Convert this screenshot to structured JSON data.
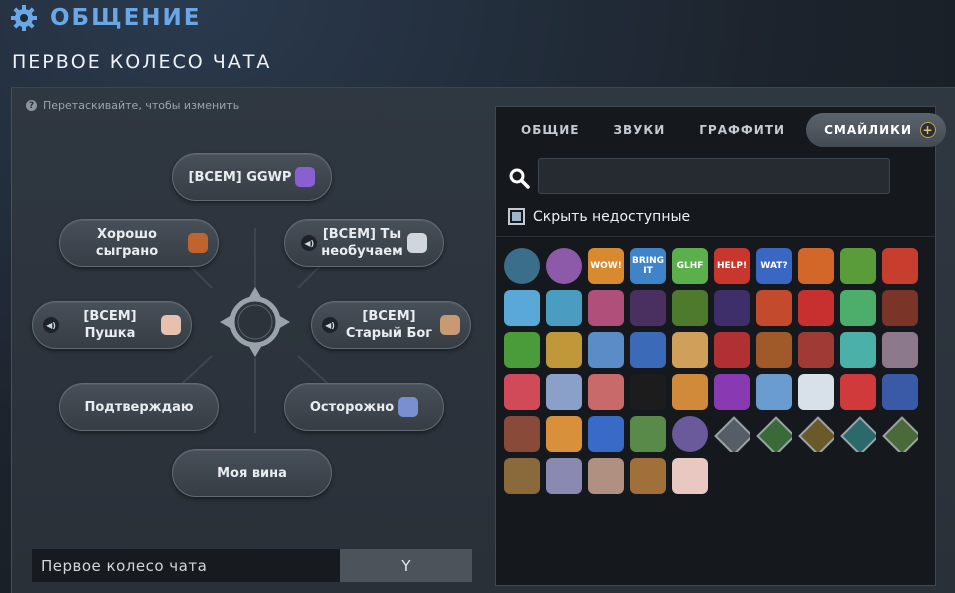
{
  "header": {
    "title": "ОБЩЕНИЕ",
    "subtitle": "ПЕРВОЕ КОЛЕСО ЧАТА",
    "accent": "#6aa7e6"
  },
  "hint": "Перетаскивайте, чтобы изменить",
  "wheel": {
    "top": {
      "text": "[ВСЕМ] GGWP",
      "emote_color": "#8a5fd0"
    },
    "upper_left": {
      "text": "Хорошо сыграно",
      "emote_color": "#c0642f"
    },
    "upper_right": {
      "text": "[ВСЕМ] Ты\nнеобучаем",
      "emote_color": "#d0d6dc"
    },
    "mid_left": {
      "text": "[ВСЕМ]\nПушка",
      "emote_color": "#e8c0b0"
    },
    "mid_right": {
      "text": "[ВСЕМ]\nСтарый Бог",
      "emote_color": "#c89a74"
    },
    "lower_left": {
      "text": "Подтверждаю"
    },
    "lower_right": {
      "text": "Осторожно",
      "emote_color": "#7a8fd0"
    },
    "bottom": {
      "text": "Моя вина"
    }
  },
  "bind": {
    "label": "Первое колесо чата",
    "key": "Y"
  },
  "tabs": [
    {
      "label": "ОБЩИЕ",
      "active": false
    },
    {
      "label": "ЗВУКИ",
      "active": false
    },
    {
      "label": "ГРАФФИТИ",
      "active": false
    },
    {
      "label": "СМАЙЛИКИ",
      "active": true
    }
  ],
  "search": {
    "value": "",
    "placeholder": ""
  },
  "hide_unavailable": {
    "label": "Скрыть недоступные",
    "checked": true
  },
  "emotes": [
    {
      "icon": "dota-logo-icon",
      "color": "#3b6e8a",
      "shape": "round"
    },
    {
      "icon": "shell-icon",
      "color": "#8c5aa8",
      "shape": "round"
    },
    {
      "icon": "wow-icon",
      "color": "#d98a2e",
      "text": "WOW!"
    },
    {
      "icon": "bring-it-icon",
      "color": "#3f84c8",
      "text": "BRING IT"
    },
    {
      "icon": "glhf-icon",
      "color": "#5bb04c",
      "text": "GLHF"
    },
    {
      "icon": "help-icon",
      "color": "#c8362e",
      "text": "HELP!"
    },
    {
      "icon": "wat-icon",
      "color": "#3a66c4",
      "text": "WAT?"
    },
    {
      "icon": "monkey-king-icon",
      "color": "#d3672a"
    },
    {
      "icon": "goblin-icon",
      "color": "#5a9c3a"
    },
    {
      "icon": "bunny-icon",
      "color": "#c83e2e"
    },
    {
      "icon": "crystal-creature-icon",
      "color": "#5aa8d8"
    },
    {
      "icon": "ice-beast-icon",
      "color": "#4a9cc0"
    },
    {
      "icon": "pig-icon",
      "color": "#b0507a"
    },
    {
      "icon": "dark-mask-icon",
      "color": "#4a3060"
    },
    {
      "icon": "witch-icon",
      "color": "#4e7a2e"
    },
    {
      "icon": "shadow-dragon-icon",
      "color": "#3e2e6a"
    },
    {
      "icon": "gift-box-icon",
      "color": "#c44a2e"
    },
    {
      "icon": "stocking-icon",
      "color": "#c83030"
    },
    {
      "icon": "green-cat-icon",
      "color": "#4cae6a"
    },
    {
      "icon": "lantern-icon",
      "color": "#7a3428"
    },
    {
      "icon": "lights-icon",
      "color": "#4a9c3a"
    },
    {
      "icon": "lion-icon",
      "color": "#c0983a"
    },
    {
      "icon": "blue-ghost-icon",
      "color": "#5c8cc8"
    },
    {
      "icon": "dragon-head-icon",
      "color": "#3a6ab8"
    },
    {
      "icon": "laughing-creature-icon",
      "color": "#d0a05a"
    },
    {
      "icon": "screaming-icon",
      "color": "#b03034"
    },
    {
      "icon": "bear-icon",
      "color": "#a05a2a"
    },
    {
      "icon": "red-face-icon",
      "color": "#a03a34"
    },
    {
      "icon": "fish-icon",
      "color": "#4ab0a8"
    },
    {
      "icon": "horned-skull-icon",
      "color": "#8c7a8c"
    },
    {
      "icon": "red-fox-icon",
      "color": "#d04a5a"
    },
    {
      "icon": "wolf-icon",
      "color": "#8aa0c8"
    },
    {
      "icon": "claw-icon",
      "color": "#c86a6a"
    },
    {
      "icon": "shadow-icon",
      "color": "#1c1c1c"
    },
    {
      "icon": "grin-icon",
      "color": "#d08a3a"
    },
    {
      "icon": "angry-icon",
      "color": "#8a3ab0"
    },
    {
      "icon": "robot-icon",
      "color": "#6a9cd0"
    },
    {
      "icon": "bird-icon",
      "color": "#d8e0ea"
    },
    {
      "icon": "goblet-icon",
      "color": "#d03a3a"
    },
    {
      "icon": "whale-icon",
      "color": "#3a5aa8"
    },
    {
      "icon": "puppet-icon",
      "color": "#8a4a3a"
    },
    {
      "icon": "cat-icon",
      "color": "#d8903a"
    },
    {
      "icon": "duck-icon",
      "color": "#3a6ac8"
    },
    {
      "icon": "sweater-icon",
      "color": "#5a8a4a"
    },
    {
      "icon": "void-orb-icon",
      "color": "#6a5a9c",
      "shape": "round"
    },
    {
      "icon": "question-rune-icon",
      "color": "#555d66",
      "shape": "diamond"
    },
    {
      "icon": "green-rune-icon",
      "color": "#3a6a3a",
      "shape": "diamond"
    },
    {
      "icon": "gold-rune-icon",
      "color": "#6a5a2a",
      "shape": "diamond"
    },
    {
      "icon": "teal-rune-icon",
      "color": "#2a6a6a",
      "shape": "diamond"
    },
    {
      "icon": "moss-rune-icon",
      "color": "#4a6a3a",
      "shape": "diamond"
    },
    {
      "icon": "crest-icon",
      "color": "#8a6a3a"
    },
    {
      "icon": "axe-icon",
      "color": "#8a8ab0"
    },
    {
      "icon": "muscle-icon",
      "color": "#b09080"
    },
    {
      "icon": "shell-curl-icon",
      "color": "#a0703a"
    },
    {
      "icon": "pale-face-icon",
      "color": "#e8c8c0"
    }
  ]
}
